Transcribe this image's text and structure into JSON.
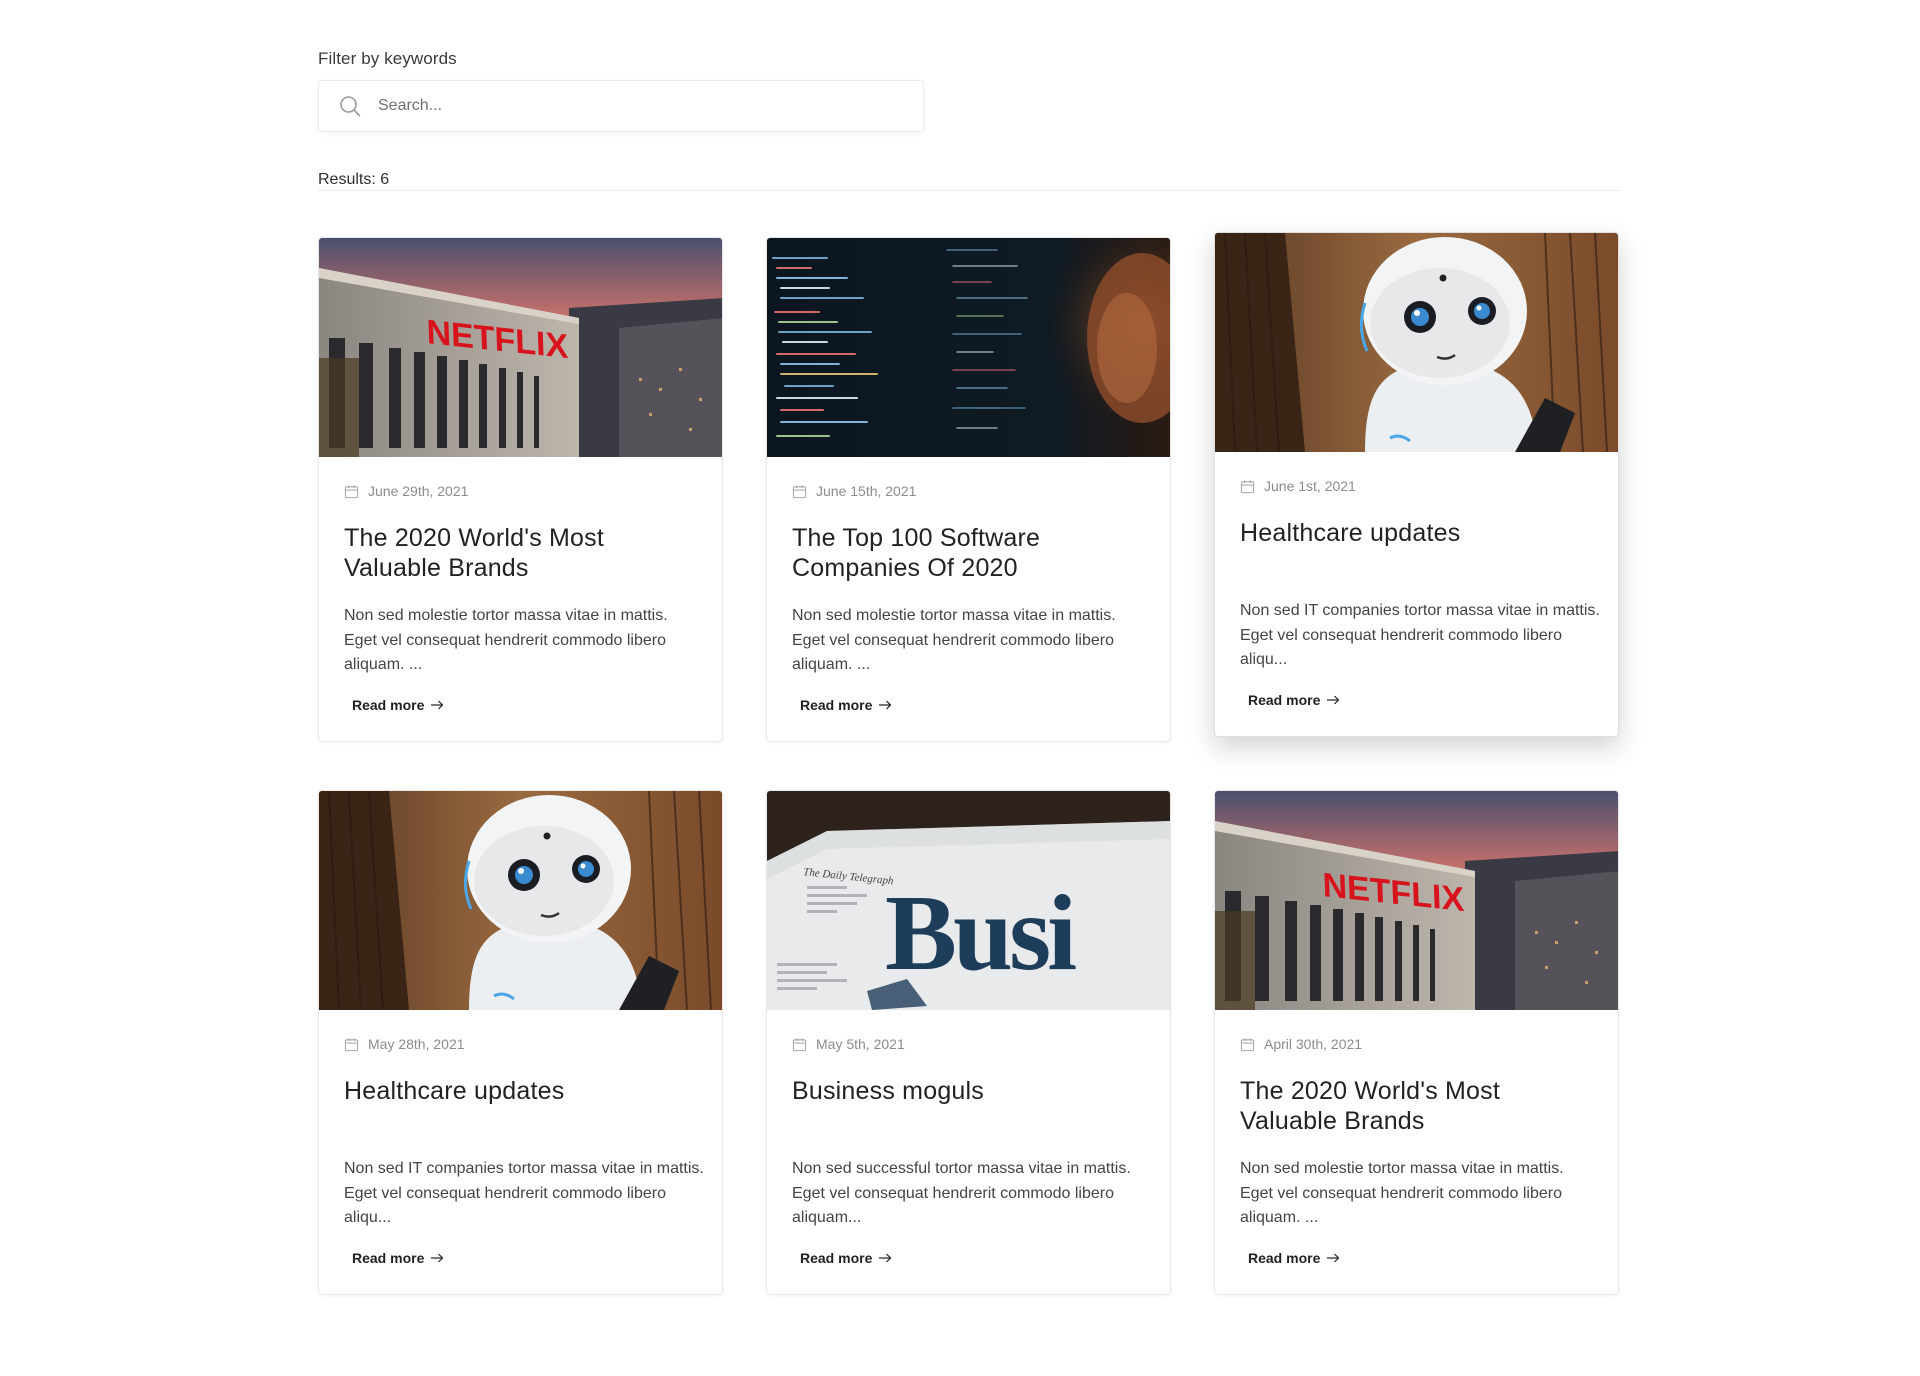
{
  "filter": {
    "label": "Filter by keywords",
    "placeholder": "Search...",
    "icon": "search-icon"
  },
  "results_text": "Results: 6",
  "read_more_label": "Read more",
  "cards": [
    {
      "date": "June 29th, 2021",
      "title": "The 2020 World's Most Valuable Brands",
      "excerpt": "Non sed molestie tortor massa vitae in mattis. Eget vel consequat hendrerit commodo libero aliquam. ...",
      "image": "netflix-building",
      "image_text": "NETFLIX"
    },
    {
      "date": "June 15th, 2021",
      "title": "The Top 100 Software Companies Of 2020",
      "excerpt": "Non sed molestie tortor massa vitae in mattis. Eget vel consequat hendrerit commodo libero aliquam. ...",
      "image": "code-screen"
    },
    {
      "date": "June 1st, 2021",
      "title": "Healthcare updates",
      "excerpt": "Non sed IT companies tortor massa vitae in mattis. Eget vel consequat hendrerit commodo libero aliqu...",
      "image": "robot"
    },
    {
      "date": "May 28th, 2021",
      "title": "Healthcare updates",
      "excerpt": "Non sed IT companies tortor massa vitae in mattis. Eget vel consequat hendrerit commodo libero aliqu...",
      "image": "robot"
    },
    {
      "date": "May 5th, 2021",
      "title": "Business moguls",
      "excerpt": "Non sed successful tortor massa vitae in mattis. Eget vel consequat hendrerit commodo libero aliquam...",
      "image": "newspaper",
      "image_text": "Busi"
    },
    {
      "date": "April 30th, 2021",
      "title": "The 2020 World's Most Valuable Brands",
      "excerpt": "Non sed molestie tortor massa vitae in mattis. Eget vel consequat hendrerit commodo libero aliquam. ...",
      "image": "netflix-building",
      "image_text": "NETFLIX"
    }
  ]
}
